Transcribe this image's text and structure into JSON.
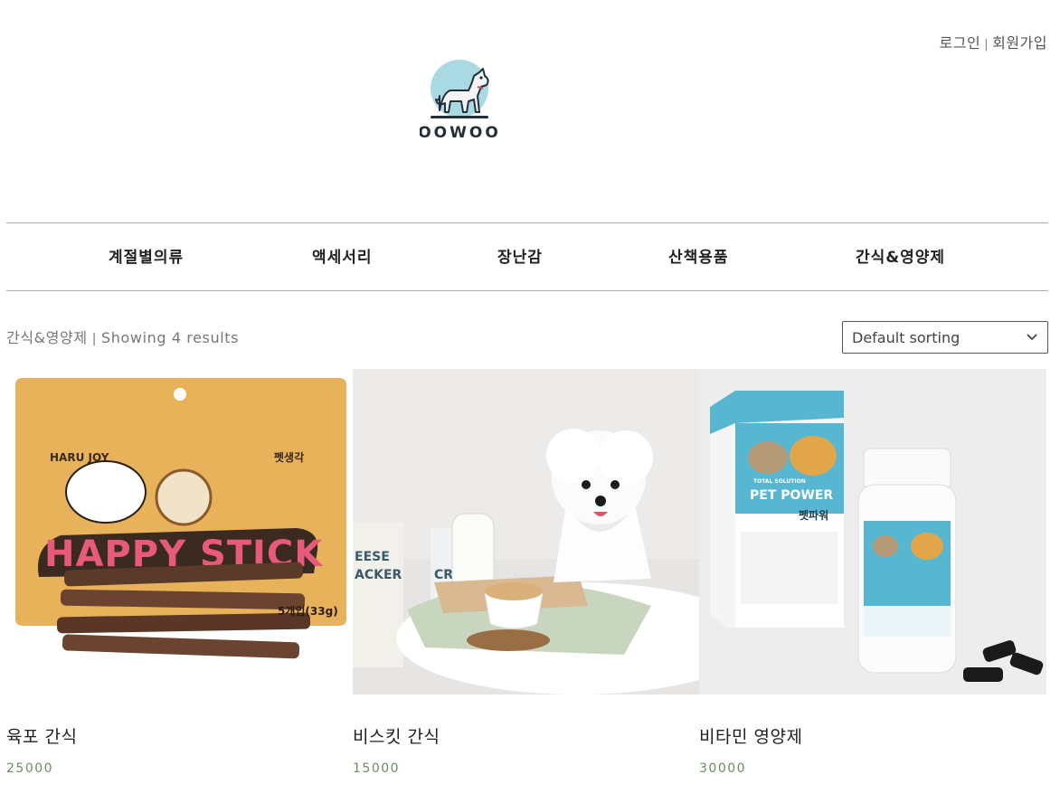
{
  "header": {
    "login_label": "로그인",
    "signup_label": "회원가입",
    "separator": "|",
    "logo_text": "OOWOO"
  },
  "nav": {
    "items": [
      {
        "label": "계절별의류"
      },
      {
        "label": "액세서리"
      },
      {
        "label": "장난감"
      },
      {
        "label": "산책용품"
      },
      {
        "label": "간식&영양제"
      }
    ]
  },
  "shop": {
    "category": "간식&영양제",
    "separator": "|",
    "count_text": "Showing 4 results",
    "sorting_selected": "Default sorting"
  },
  "products": [
    {
      "name": "육포 간식",
      "price": "25000",
      "image_text": {
        "brand": "HARU JOY",
        "maker": "펫생각",
        "stick": "HAPPY STICK",
        "weight": "5개입(33g)"
      }
    },
    {
      "name": "비스킷 간식",
      "price": "15000",
      "image_text": {
        "bag_line1": "EESE",
        "bag_line2": "ACKER",
        "bag2": "CR"
      }
    },
    {
      "name": "비타민 영양제",
      "price": "30000",
      "image_text": {
        "sub": "TOTAL SOLUTION",
        "title": "PET POWER",
        "korean": "펫파워"
      }
    }
  ],
  "colors": {
    "price": "#6b8f5e",
    "rule": "#a9a9a9",
    "pouch": "#e8b25a",
    "box_blue": "#57b6d0"
  }
}
